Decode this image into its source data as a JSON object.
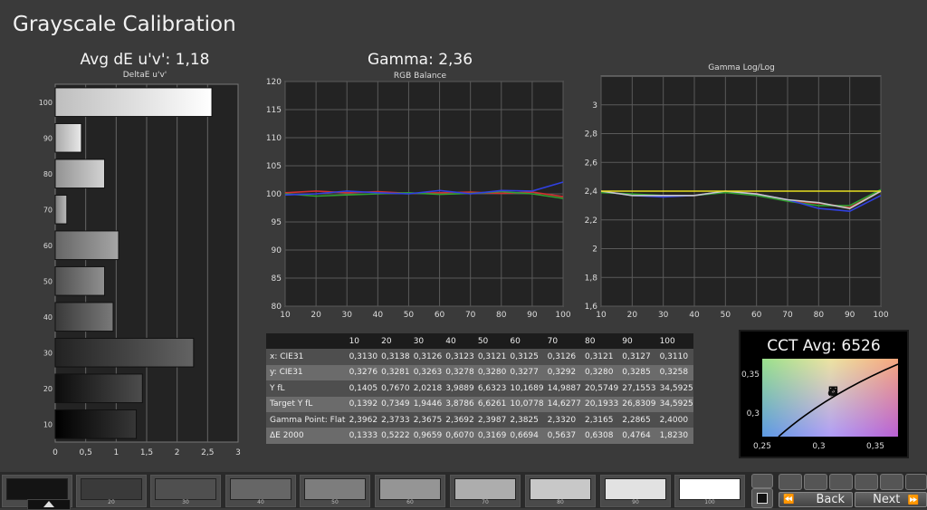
{
  "page": {
    "title": "Grayscale Calibration"
  },
  "chart_data": [
    {
      "type": "bar",
      "title": "Avg dE u'v': 1,18",
      "subtitle": "DeltaE u'v'",
      "orientation": "horizontal",
      "categories": [
        "10",
        "20",
        "30",
        "40",
        "50",
        "60",
        "70",
        "80",
        "90",
        "100"
      ],
      "values": [
        1.33,
        1.43,
        2.27,
        0.95,
        0.81,
        1.04,
        0.19,
        0.81,
        0.43,
        2.57
      ],
      "xlim": [
        0,
        3
      ],
      "xticks": [
        "0",
        "0,5",
        "1",
        "1,5",
        "2",
        "2,5",
        "3"
      ],
      "grid": true
    },
    {
      "type": "line",
      "title": "Gamma: 2,36",
      "subtitle": "RGB Balance",
      "x": [
        10,
        20,
        30,
        40,
        50,
        60,
        70,
        80,
        90,
        100
      ],
      "series": [
        {
          "color": "#d03030",
          "values": [
            100.2,
            100.5,
            100.2,
            100.4,
            100.1,
            100.2,
            100.3,
            100.1,
            100.3,
            99.5
          ]
        },
        {
          "color": "#30a030",
          "values": [
            100.0,
            99.6,
            99.8,
            100.0,
            100.2,
            99.9,
            100.1,
            100.4,
            100.0,
            99.2
          ]
        },
        {
          "color": "#3040e0",
          "values": [
            99.8,
            100.0,
            100.5,
            100.2,
            100.0,
            100.6,
            100.0,
            100.6,
            100.5,
            102.1
          ]
        }
      ],
      "xlim": [
        10,
        100
      ],
      "ylim": [
        80,
        120
      ],
      "xticks": [
        "10",
        "20",
        "30",
        "40",
        "50",
        "60",
        "70",
        "80",
        "90",
        "100"
      ],
      "yticks": [
        "80",
        "85",
        "90",
        "95",
        "100",
        "105",
        "110",
        "115",
        "120"
      ],
      "grid": true
    },
    {
      "type": "line",
      "title": "Gamma Log/Log",
      "x": [
        10,
        20,
        30,
        40,
        50,
        60,
        70,
        80,
        90,
        100
      ],
      "series": [
        {
          "color": "#d03030",
          "values": [
            2.3962,
            2.3733,
            2.3675,
            2.3692,
            2.3987,
            2.3825,
            2.332,
            2.3165,
            2.2865,
            2.4
          ]
        },
        {
          "color": "#30a030",
          "values": [
            2.39,
            2.38,
            2.37,
            2.37,
            2.39,
            2.37,
            2.33,
            2.3,
            2.3,
            2.41
          ]
        },
        {
          "color": "#3040e0",
          "values": [
            2.4,
            2.37,
            2.36,
            2.37,
            2.4,
            2.38,
            2.34,
            2.28,
            2.26,
            2.37
          ]
        },
        {
          "color": "#c8c8c8",
          "values": [
            2.4,
            2.37,
            2.37,
            2.37,
            2.4,
            2.38,
            2.34,
            2.32,
            2.28,
            2.4
          ]
        },
        {
          "color": "#e8e020",
          "values": [
            2.4,
            2.4,
            2.4,
            2.4,
            2.4,
            2.4,
            2.4,
            2.4,
            2.4,
            2.4
          ]
        }
      ],
      "xlim": [
        10,
        100
      ],
      "ylim": [
        1.6,
        3.2
      ],
      "xticks": [
        "10",
        "20",
        "30",
        "40",
        "50",
        "60",
        "70",
        "80",
        "90",
        "100"
      ],
      "yticks": [
        "1,6",
        "1,8",
        "2",
        "2,2",
        "2,4",
        "2,6",
        "2,8",
        "3"
      ],
      "grid": true
    },
    {
      "type": "table",
      "columns": [
        "",
        "10",
        "20",
        "30",
        "40",
        "50",
        "60",
        "70",
        "80",
        "90",
        "100"
      ],
      "rows": [
        [
          "x: CIE31",
          "0,3130",
          "0,3138",
          "0,3126",
          "0,3123",
          "0,3121",
          "0,3125",
          "0,3126",
          "0,3121",
          "0,3127",
          "0,3110"
        ],
        [
          "y: CIE31",
          "0,3276",
          "0,3281",
          "0,3263",
          "0,3278",
          "0,3280",
          "0,3277",
          "0,3292",
          "0,3280",
          "0,3285",
          "0,3258"
        ],
        [
          "Y fL",
          "0,1405",
          "0,7670",
          "2,0218",
          "3,9889",
          "6,6323",
          "10,1689",
          "14,9887",
          "20,5749",
          "27,1553",
          "34,5925"
        ],
        [
          "Target Y fL",
          "0,1392",
          "0,7349",
          "1,9446",
          "3,8786",
          "6,6261",
          "10,0778",
          "14,6277",
          "20,1933",
          "26,8309",
          "34,5925"
        ],
        [
          "Gamma Point: Flat",
          "2,3962",
          "2,3733",
          "2,3675",
          "2,3692",
          "2,3987",
          "2,3825",
          "2,3320",
          "2,3165",
          "2,2865",
          "2,4000"
        ],
        [
          "ΔE 2000",
          "0,1333",
          "0,5222",
          "0,9659",
          "0,6070",
          "0,3169",
          "0,6694",
          "0,5637",
          "0,6308",
          "0,4764",
          "1,8230"
        ]
      ]
    },
    {
      "type": "scatter",
      "title": "CCT Avg: 6526",
      "xlim": [
        0.25,
        0.37
      ],
      "ylim": [
        0.27,
        0.37
      ],
      "xticks": [
        "0,25",
        "0,3",
        "0,35"
      ],
      "yticks": [
        "0,3",
        "0,35"
      ],
      "target": [
        0.3127,
        0.329
      ],
      "points": [
        [
          0.313,
          0.3276
        ],
        [
          0.3138,
          0.3281
        ],
        [
          0.3126,
          0.3263
        ],
        [
          0.3123,
          0.3278
        ],
        [
          0.3121,
          0.328
        ],
        [
          0.3125,
          0.3277
        ],
        [
          0.3126,
          0.3292
        ],
        [
          0.3121,
          0.328
        ],
        [
          0.3127,
          0.3285
        ],
        [
          0.311,
          0.3258
        ]
      ]
    }
  ],
  "swatches": [
    {
      "label": "",
      "color": "#141414"
    },
    {
      "label": "20",
      "color": "#3a3a3a"
    },
    {
      "label": "30",
      "color": "#4f4f4f"
    },
    {
      "label": "40",
      "color": "#666666"
    },
    {
      "label": "50",
      "color": "#7d7d7d"
    },
    {
      "label": "60",
      "color": "#959595"
    },
    {
      "label": "70",
      "color": "#adadad"
    },
    {
      "label": "80",
      "color": "#c8c8c8"
    },
    {
      "label": "90",
      "color": "#e2e2e2"
    },
    {
      "label": "100",
      "color": "#ffffff"
    }
  ],
  "nav": {
    "back_label": "Back",
    "next_label": "Next"
  }
}
